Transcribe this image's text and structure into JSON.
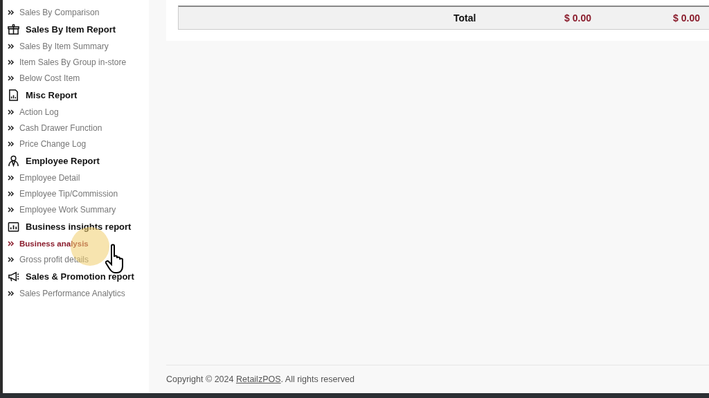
{
  "sidebar": {
    "sections": [
      {
        "items": [
          {
            "label": "Sales By Comparison",
            "selected": false
          }
        ]
      },
      {
        "kind": "gift",
        "heading": "Sales By Item Report",
        "items": [
          {
            "label": "Sales By Item Summary",
            "selected": false
          },
          {
            "label": "Item Sales By Group in-store",
            "selected": false
          },
          {
            "label": "Below Cost Item",
            "selected": false
          }
        ]
      },
      {
        "kind": "document",
        "heading": "Misc Report",
        "items": [
          {
            "label": "Action Log",
            "selected": false
          },
          {
            "label": "Cash Drawer Function",
            "selected": false
          },
          {
            "label": "Price Change Log",
            "selected": false
          }
        ]
      },
      {
        "kind": "person",
        "heading": "Employee Report",
        "items": [
          {
            "label": "Employee Detail",
            "selected": false
          },
          {
            "label": "Employee Tip/Commission",
            "selected": false
          },
          {
            "label": "Employee Work Summary",
            "selected": false
          }
        ]
      },
      {
        "kind": "chart",
        "heading": "Business insights report",
        "items": [
          {
            "label": "Business analysis",
            "selected": true
          },
          {
            "label": "Gross profit details",
            "selected": false
          }
        ]
      },
      {
        "kind": "megaphone",
        "heading": "Sales & Promotion report",
        "items": [
          {
            "label": "Sales Performance Analytics",
            "selected": false
          }
        ]
      }
    ]
  },
  "table": {
    "total_row": {
      "label": "Total",
      "values": [
        "$ 0.00",
        "$ 0.00"
      ]
    }
  },
  "footer": {
    "text_before": "Copyright © 2024 ",
    "link": "RetailzPOS",
    "text_after": ". All rights reserved"
  }
}
